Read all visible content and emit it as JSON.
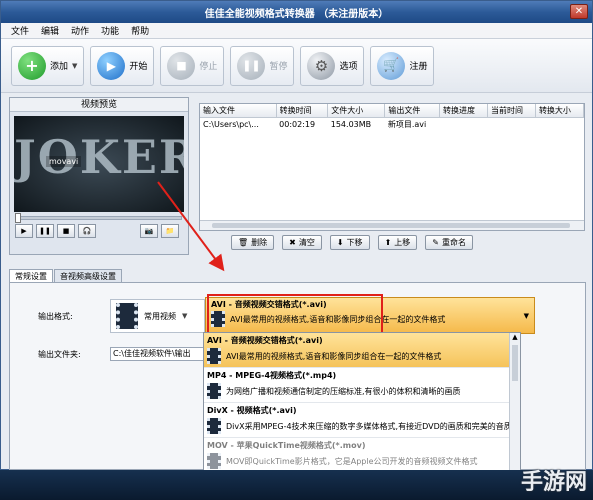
{
  "window": {
    "title": "佳佳全能视频格式转换器 （未注册版本）",
    "close_label": "✕"
  },
  "menu": [
    "文件",
    "编辑",
    "动作",
    "功能",
    "帮助"
  ],
  "toolbar": {
    "add": "添加",
    "start": "开始",
    "stop": "停止",
    "pause": "暂停",
    "options": "选项",
    "register": "注册"
  },
  "preview": {
    "title": "视频预览",
    "video_title": "JOKER",
    "watermark": "movavi"
  },
  "filelist": {
    "headers": [
      "输入文件",
      "转换时间",
      "文件大小",
      "输出文件",
      "转换进度",
      "当前时间",
      "转换大小"
    ],
    "rows": [
      [
        "C:\\Users\\pc\\...",
        "00:02:19",
        "154.03MB",
        "新项目.avi",
        "",
        "",
        ""
      ]
    ]
  },
  "listbuttons": {
    "delete": "删除",
    "clear": "清空",
    "down": "下移",
    "up": "上移",
    "rename": "重命名"
  },
  "tabs": [
    "常规设置",
    "音视频高级设置"
  ],
  "settings": {
    "format_label": "输出格式:",
    "format_category": "常用视频",
    "selected_title": "AVI - 音频视频交错格式(*.avi)",
    "selected_desc": "AVI最常用的视频格式,语音和影像同步组合在一起的文件格式",
    "folder_label": "输出文件夹:",
    "folder_value": "C:\\佳佳视频软件\\输出"
  },
  "dropdown": [
    {
      "title": "AVI - 音频视频交错格式(*.avi)",
      "desc": "AVI最常用的视频格式,语音和影像同步组合在一起的文件格式"
    },
    {
      "title": "MP4 - MPEG-4视频格式(*.mp4)",
      "desc": "为网络广播和视频通信制定的压缩标准,有很小的体积和清晰的画质"
    },
    {
      "title": "DivX - 视频格式(*.avi)",
      "desc": "DivX采用MPEG-4技术来压缩的数字多媒体格式,有接近DVD的画质和完美的音质"
    },
    {
      "title": "MOV - 苹果QuickTime视频格式(*.mov)",
      "desc": "MOV即QuickTime影片格式，它是Apple公司开发的音频视频文件格式"
    }
  ],
  "watermark": "手游网",
  "colors": {
    "highlight": "#f5b94a",
    "annotation": "#e0211a",
    "titlebar": "#2c5a98"
  }
}
